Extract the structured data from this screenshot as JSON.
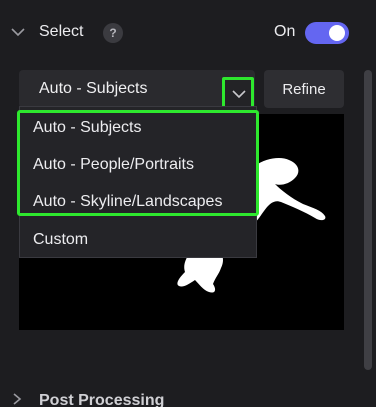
{
  "section": {
    "title": "Select",
    "help_label": "?",
    "toggle_label": "On",
    "toggle_on": true
  },
  "select": {
    "current_value": "Auto - Subjects",
    "refine_label": "Refine"
  },
  "dropdown": {
    "options": [
      "Auto - Subjects",
      "Auto - People/Portraits",
      "Auto - Skyline/Landscapes",
      "Custom"
    ],
    "highlighted_count": 3
  },
  "next_section": {
    "title": "Post Processing"
  },
  "colors": {
    "accent_toggle": "#6466f1",
    "highlight_outline": "#2ee82e",
    "panel_bg": "#1d1d20"
  },
  "icons": [
    "chevron-down-icon",
    "help-icon",
    "chevron-right-icon"
  ]
}
